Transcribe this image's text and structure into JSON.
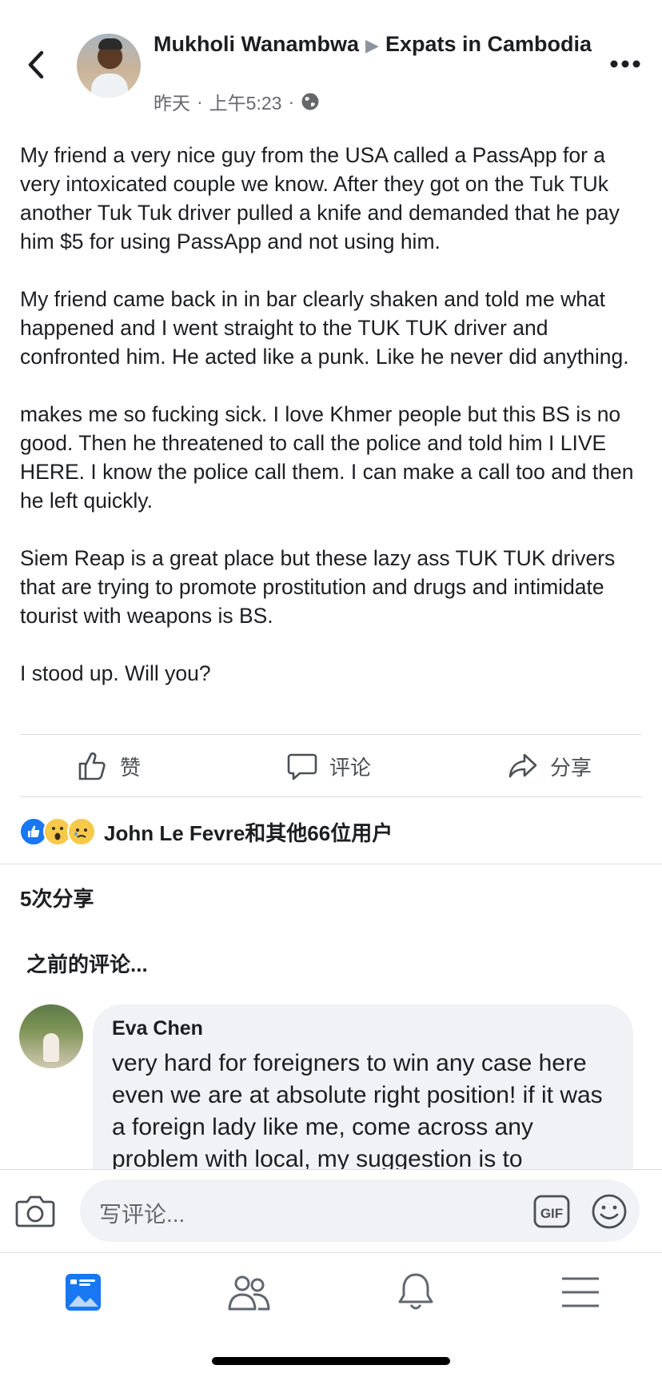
{
  "header": {
    "author": "Mukholi Wanambwa",
    "group": "Expats in Cambodia",
    "day": "昨天",
    "time": "上午5:23",
    "separator": "·",
    "icons": {
      "back": "chevron-left-icon",
      "privacy": "globe-icon",
      "more": "more-horizontal-icon"
    }
  },
  "post": {
    "paragraphs": [
      "My friend a very nice guy from the USA called a PassApp for a very intoxicated couple we know. After they got on the Tuk TUk another Tuk Tuk driver pulled a knife and demanded that he pay him $5 for using PassApp and not using him.",
      "My friend came back in in bar clearly shaken and told me what happened and I went straight to the TUK TUK driver and confronted him. He acted like a punk. Like he never did anything.",
      "makes me so fucking sick. I love Khmer people but this BS is no good. Then he threatened to call the police and told him I LIVE HERE. I know the police call them. I can make a call too and then he left quickly.",
      "Siem Reap is a great place but these lazy ass TUK TUK drivers that are trying to promote prostitution and drugs and intimidate tourist with weapons is BS.",
      "I stood up. Will you?"
    ]
  },
  "actions": {
    "like": "赞",
    "comment": "评论",
    "share": "分享"
  },
  "reactions": {
    "text": "John Le Fevre和其他66位用户",
    "types": [
      "like",
      "wow",
      "sad"
    ]
  },
  "shares": "5次分享",
  "previous_comments": "之前的评论...",
  "comment": {
    "author": "Eva Chen",
    "text": "very hard for foreigners to win any case here even we are at absolute right position! if it was a foreign lady like me, come across any problem with local, my suggestion is to"
  },
  "composer": {
    "placeholder": "写评论...",
    "gif": "GIF"
  },
  "tabs": [
    "news-feed-icon",
    "groups-icon",
    "notifications-icon",
    "menu-icon"
  ],
  "colors": {
    "brand": "#1877f2",
    "text": "#1c1e21",
    "secondary": "#65676b",
    "bubble": "#f0f2f5"
  }
}
